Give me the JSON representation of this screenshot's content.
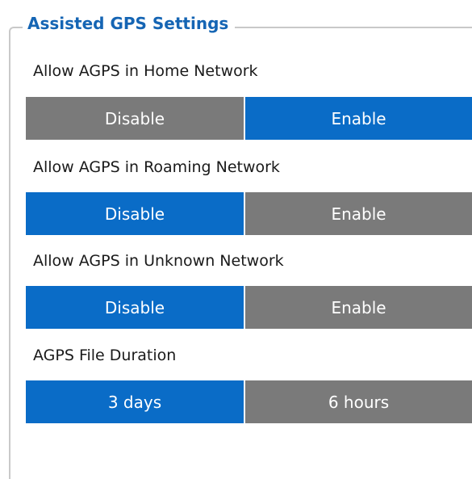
{
  "group": {
    "title": "Assisted GPS Settings"
  },
  "settings": [
    {
      "label": "Allow AGPS in Home Network",
      "options": [
        "Disable",
        "Enable"
      ],
      "selected": "Enable"
    },
    {
      "label": "Allow AGPS in Roaming Network",
      "options": [
        "Disable",
        "Enable"
      ],
      "selected": "Disable"
    },
    {
      "label": "Allow AGPS in Unknown Network",
      "options": [
        "Disable",
        "Enable"
      ],
      "selected": "Disable"
    },
    {
      "label": "AGPS File Duration",
      "options": [
        "3 days",
        "6 hours"
      ],
      "selected": "3 days"
    }
  ],
  "colors": {
    "selected": "#0a6cc7",
    "unselected": "#7a7a7a",
    "title": "#1565b4"
  }
}
